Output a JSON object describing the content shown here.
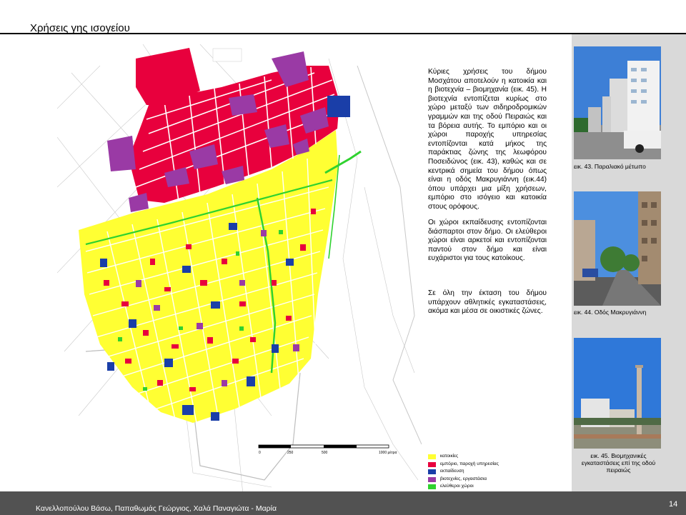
{
  "page": {
    "title": "Χρήσεις γης ισογείου",
    "authors": "Κανελλοπούλου Βάσω, Παπαθωμάς Γεώργιος, Χαλά Παναγιώτα - Μαρία",
    "page_number": "14"
  },
  "text": {
    "para1": "Κύριες χρήσεις του δήμου Μοσχάτου αποτελούν η κατοικία και η βιοτεχνία – βιομηχανία (εικ. 45). Η βιοτεχνία εντοπίζεται κυρίως στο χώρο μεταξύ των σιδηροδρομικών γραμμών και της οδού Πειραιώς και τα βόρεια αυτής. Το εμπόριο και οι χώροι παροχής υπηρεσίας εντοπίζονται κατά μήκος της παράκτιας ζώνης της λεωφόρου Ποσειδώνος (εικ. 43), καθώς και σε κεντρικά σημεία του δήμου όπως είναι η οδός Μακρυγιάννη (εικ.44) όπου υπάρχει μια μίξη χρήσεων, εμπόριο στο ισόγειο και κατοικία στους ορόφους.",
    "para2": "Οι χώροι εκπαίδευσης εντοπίζονται διάσπαρτοι στον δήμο. Οι ελεύθεροι χώροι είναι αρκετοί και εντοπίζονται παντού στον δήμο και είναι ευχάριστοι για τους κατοίκους.",
    "para3": "Σε όλη την έκταση του δήμου υπάρχουν αθλητικές εγκαταστάσεις, ακόμα και μέσα σε οικιστικές ζώνες."
  },
  "figures": {
    "caption1": "εικ. 43. Παραλιακό μέτωπο",
    "caption2": "εικ. 44. Οδός Μακρυγιάννη",
    "caption3": "εικ. 45. Βιομηχανικές εγκαταστάσεις επί της οδού πειραιώς"
  },
  "map": {
    "scale": [
      "0",
      "250",
      "500",
      "1000 μέτρα"
    ],
    "legend": [
      {
        "label": "κατοικίες",
        "color": "#ffff33"
      },
      {
        "label": "εμπόριο, παροχή υπηρεσίας",
        "color": "#e8003d"
      },
      {
        "label": "εκπαίδευση",
        "color": "#1a3ea8"
      },
      {
        "label": "βιοτεχνίες, εργαστάσια",
        "color": "#9a3aa5"
      },
      {
        "label": "ελεύθεροι χώροι",
        "color": "#2fd22f"
      }
    ]
  }
}
